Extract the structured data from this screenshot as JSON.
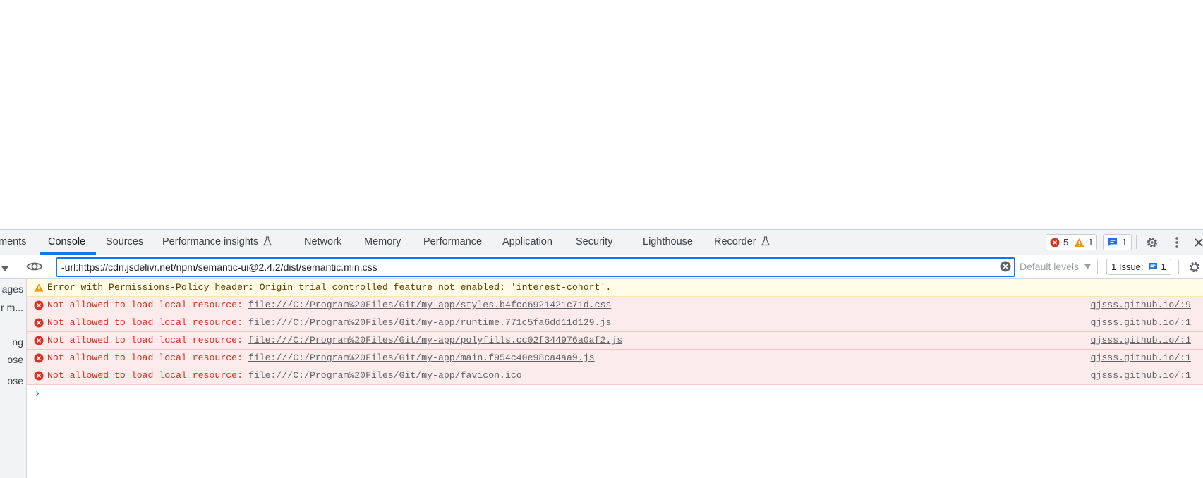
{
  "devtools": {
    "tabs": [
      {
        "label": "ments"
      },
      {
        "label": "Console"
      },
      {
        "label": "Sources"
      },
      {
        "label": "Performance insights"
      },
      {
        "label": "Network"
      },
      {
        "label": "Memory"
      },
      {
        "label": "Performance"
      },
      {
        "label": "Application"
      },
      {
        "label": "Security"
      },
      {
        "label": "Lighthouse"
      },
      {
        "label": "Recorder"
      }
    ],
    "active_tab": "Console",
    "error_count": "5",
    "warning_count": "1",
    "message_count": "1"
  },
  "filter": {
    "value": "-url:https://cdn.jsdelivr.net/npm/semantic-ui@2.4.2/dist/semantic.min.css",
    "levels_label": "Default levels",
    "issues_label": "1 Issue:",
    "issues_count": "1"
  },
  "sidebar": {
    "items": [
      "ages",
      "r m...",
      "",
      "ng",
      "ose"
    ]
  },
  "console": {
    "warning": {
      "text": "Error with Permissions-Policy header: Origin trial controlled feature not enabled: 'interest-cohort'."
    },
    "errors": [
      {
        "prefix": "Not allowed to load local resource: ",
        "url": "file:///C:/Program%20Files/Git/my-app/styles.b4fcc6921421c71d.css",
        "source": "qjsss.github.io/:9"
      },
      {
        "prefix": "Not allowed to load local resource: ",
        "url": "file:///C:/Program%20Files/Git/my-app/runtime.771c5fa6dd11d129.js",
        "source": "qjsss.github.io/:1"
      },
      {
        "prefix": "Not allowed to load local resource: ",
        "url": "file:///C:/Program%20Files/Git/my-app/polyfills.cc02f344976a0af2.js",
        "source": "qjsss.github.io/:1"
      },
      {
        "prefix": "Not allowed to load local resource: ",
        "url": "file:///C:/Program%20Files/Git/my-app/main.f954c40e98ca4aa9.js",
        "source": "qjsss.github.io/:1"
      },
      {
        "prefix": "Not allowed to load local resource: ",
        "url": "file:///C:/Program%20Files/Git/my-app/favicon.ico",
        "source": "qjsss.github.io/:1"
      }
    ],
    "prompt_glyph": "›"
  },
  "colors": {
    "accent": "#1a73e8",
    "error": "#d93025",
    "warning": "#f29900"
  }
}
